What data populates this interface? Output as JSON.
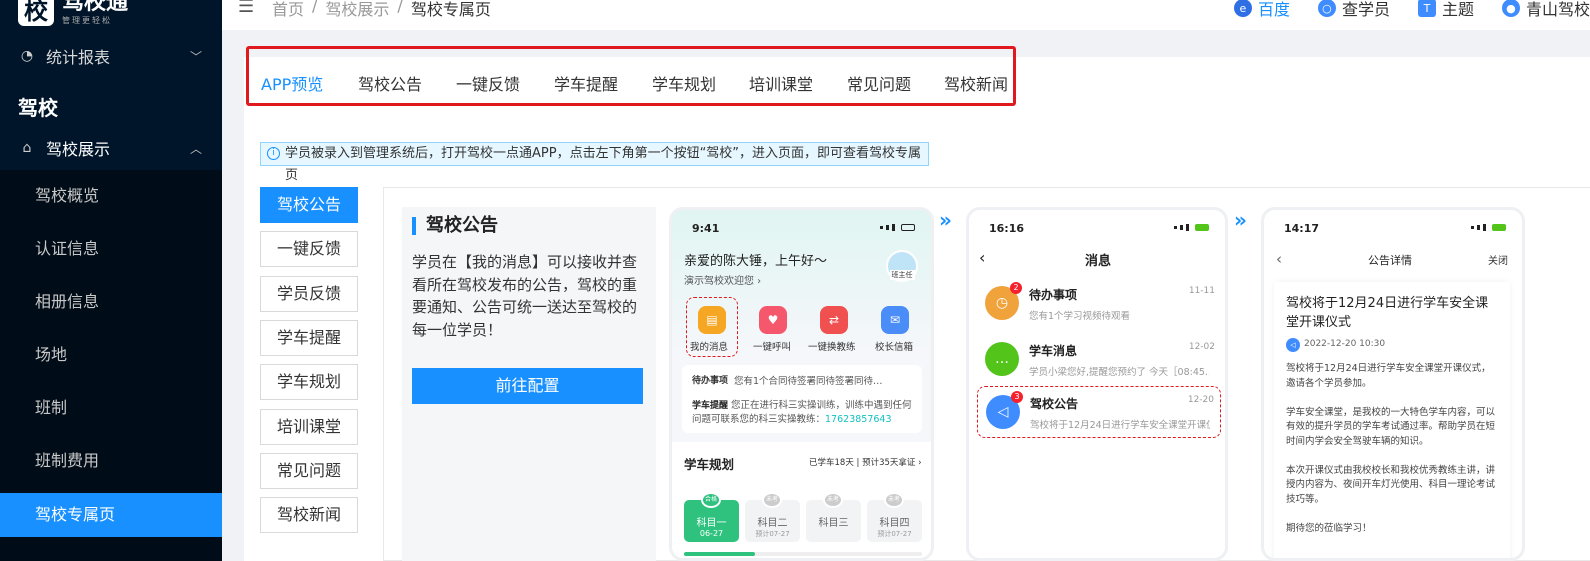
{
  "sidebar": {
    "logo_char": "校",
    "logo_name": "驾校通",
    "logo_slogan": "管理更轻松",
    "stats_menu": "统计报表",
    "group_label": "驾校",
    "school_menu": "驾校展示",
    "items": [
      "驾校概览",
      "认证信息",
      "相册信息",
      "场地",
      "班制",
      "班制费用",
      "驾校专属页"
    ]
  },
  "topbar": {
    "breadcrumb": [
      "首页",
      "驾校展示",
      "驾校专属页"
    ],
    "links": [
      {
        "label": "百度",
        "icon": "browser-icon"
      },
      {
        "label": "查学员",
        "icon": "search-student-icon"
      },
      {
        "label": "主题",
        "icon": "shirt-icon"
      },
      {
        "label": "青山驾校",
        "icon": "user-icon"
      }
    ]
  },
  "tabs": [
    "APP预览",
    "驾校公告",
    "一键反馈",
    "学车提醒",
    "学车规划",
    "培训课堂",
    "常见问题",
    "驾校新闻"
  ],
  "notice": "学员被录入到管理系统后，打开驾校一点通APP，点击左下角第一个按钮“驾校”，进入页面，即可查看驾校专属页",
  "vertical_tabs": [
    "驾校公告",
    "一键反馈",
    "学员反馈",
    "学车提醒",
    "学车规划",
    "培训课堂",
    "常见问题",
    "驾校新闻"
  ],
  "desc": {
    "title": "驾校公告",
    "text": "学员在【我的消息】可以接收并查看所在驾校发布的公告，驾校的重要通知、公告可统一送达至驾校的每一位学员！",
    "button": "前往配置"
  },
  "phone1": {
    "time": "9:41",
    "greeting": "亲爱的陈大锤，上午好～",
    "welcome": "演示驾校欢迎您 ›",
    "avatar_label": "班主任",
    "icons": [
      "我的消息",
      "一键呼叫",
      "一键换教练",
      "校长信箱"
    ],
    "todo_tag": "待办事项",
    "todo_text": "您有1个合同待签署同待签署同待…",
    "remind_tag": "学车提醒",
    "remind_text": "您正在进行科三实操训练，训练中遇到任何问题可联系您的科三实操教练：",
    "remind_phone": "17623857643",
    "plan_title": "学车规划",
    "plan_meta": "已学车18天 | 预计35天拿证 ›",
    "subjects": [
      {
        "badge": "合格",
        "name": "科目一",
        "date": "06-27"
      },
      {
        "badge": "未考",
        "name": "科目二",
        "date": "预计07-27"
      },
      {
        "badge": "未考",
        "name": "科目三",
        "date": ""
      },
      {
        "badge": "未考",
        "name": "科目四",
        "date": "预计07-27"
      }
    ]
  },
  "phone2": {
    "time": "16:16",
    "title": "消息",
    "messages": [
      {
        "title": "待办事项",
        "date": "11-11",
        "sub": "您有1个学习视频待观看",
        "badge": "2",
        "color": "#f0a23b"
      },
      {
        "title": "学车消息",
        "date": "12-02",
        "sub": "学员小梁您好,提醒您预约了 今天［08:45...",
        "badge": "",
        "color": "#52c41a"
      },
      {
        "title": "驾校公告",
        "date": "12-20",
        "sub": "驾校将于12月24日进行学车安全课堂开课仪式",
        "badge": "3",
        "color": "#3f8cff"
      }
    ]
  },
  "phone3": {
    "time": "14:17",
    "title": "公告详情",
    "close": "关闭",
    "heading": "驾校将于12月24日进行学车安全课堂开课仪式",
    "date": "2022-12-20 10:30",
    "paragraphs": [
      "驾校将于12月24日进行学车安全课堂开课仪式，邀请各个学员参加。",
      "学车安全课堂，是我校的一大特色学车内容，可以有效的提升学员的学车考试通过率。帮助学员在短时间内学会安全驾驶车辆的知识。",
      "本次开课仪式由我校校长和我校优秀教练主讲，讲授内内容为、夜间开车灯光使用、科目一理论考试技巧等。",
      "期待您的莅临学习！"
    ]
  },
  "colors": {
    "primary": "#1890ff",
    "sidebar": "#001529",
    "highlight": "#e0191f"
  }
}
